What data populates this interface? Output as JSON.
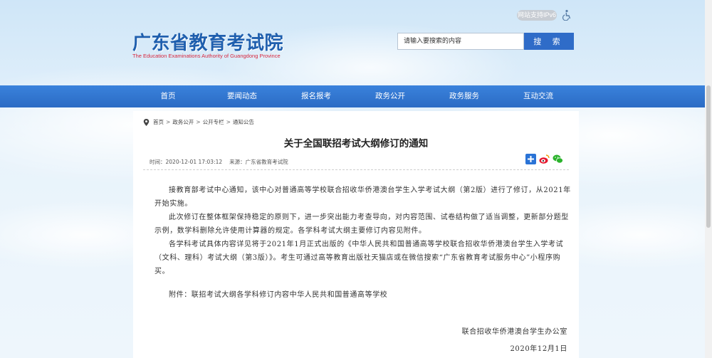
{
  "header": {
    "ipv6_badge": "网站支持IPv6",
    "logo_cn": "广东省教育考试院",
    "logo_en": "The Education Examinations Authority of Guangdong Province",
    "search_placeholder": "请输入要搜索的内容",
    "search_button": "搜 索",
    "icons": [
      "accessibility-icon",
      "location-pin-icon",
      "share-plus-icon",
      "weibo-icon",
      "wechat-icon"
    ]
  },
  "nav": {
    "items": [
      "首页",
      "要闻动态",
      "报名报考",
      "政务公开",
      "政务服务",
      "互动交流"
    ]
  },
  "breadcrumb": [
    "首页",
    "政务公开",
    "公开专栏",
    "通知公告"
  ],
  "article": {
    "title": "关于全国联招考试大纲修订的通知",
    "time": "时间：2020-12-01 17:03:12",
    "source": "来源：广东省教育考试院",
    "paragraphs": [
      "接教育部考试中心通知，该中心对普通高等学校联合招收华侨港澳台学生入学考试大纲（第2版）进行了修订，从2021年开始实施。",
      "此次修订在整体框架保持稳定的原则下，进一步突出能力考查导向，对内容范围、试卷结构做了适当调整，更新部分题型示例，数学科删除允许使用计算器的规定。各学科考试大纲主要修订内容见附件。",
      "各学科考试具体内容详见将于2021年1月正式出版的《中华人民共和国普通高等学校联合招收华侨港澳台学生入学考试（文科、理科）考试大纲（第3版）》。考生可通过高等教育出版社天猫店或在微信搜索“广东省教育考试服务中心”小程序购买。"
    ],
    "attachment": "附件：联招考试大纲各学科修订内容中华人民共和国普通高等学校",
    "signature": "联合招收华侨港澳台学生办公室",
    "date": "2020年12月1日"
  },
  "colors": {
    "nav_blue": "#2f6cc8",
    "logo_blue": "#1f5fae",
    "logo_en_red": "#d7263d"
  }
}
